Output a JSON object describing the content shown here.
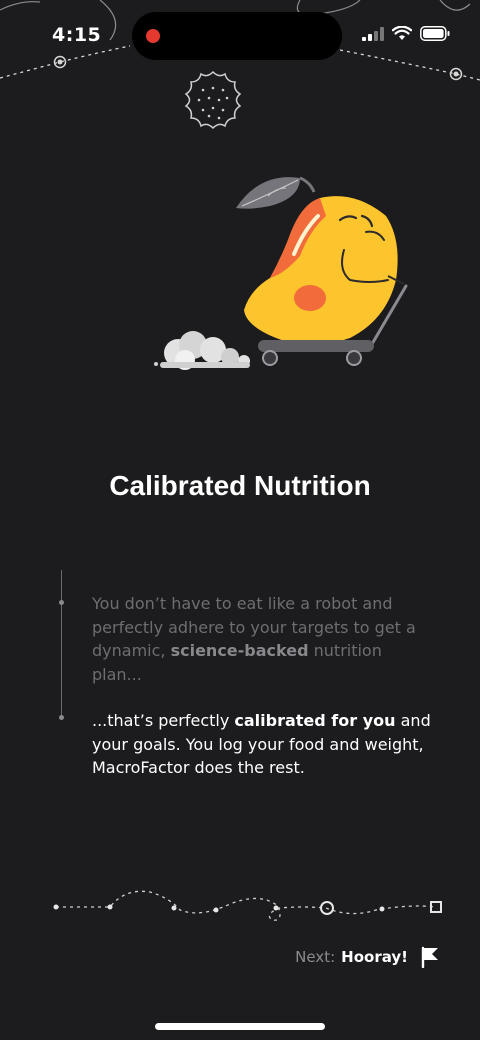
{
  "status_bar": {
    "time": "4:15"
  },
  "onboarding": {
    "title": "Calibrated Nutrition",
    "paragraph_1": {
      "before": "You don’t have to eat like a robot and perfectly adhere to your targets to get a dynamic,",
      "bold": "science-backed",
      "after": " nutrition plan..."
    },
    "paragraph_2": {
      "before": "...that’s perfectly",
      "bold": "calibrated for you",
      "after": "and your goals. You log your food and weight, MacroFactor does the rest."
    }
  },
  "footer": {
    "next_prefix": "Next:",
    "next_label": "Hooray!"
  },
  "icons": {
    "wifi": "wifi-icon",
    "battery": "battery-icon",
    "signal": "signal-icon",
    "flag": "flag-icon",
    "cookie": "cookie-icon"
  },
  "colors": {
    "background": "#1c1b1d",
    "muted_text": "#6e6d72",
    "accent_yellow": "#fbc02d",
    "accent_orange": "#f26b3a",
    "record_red": "#e5392f"
  }
}
